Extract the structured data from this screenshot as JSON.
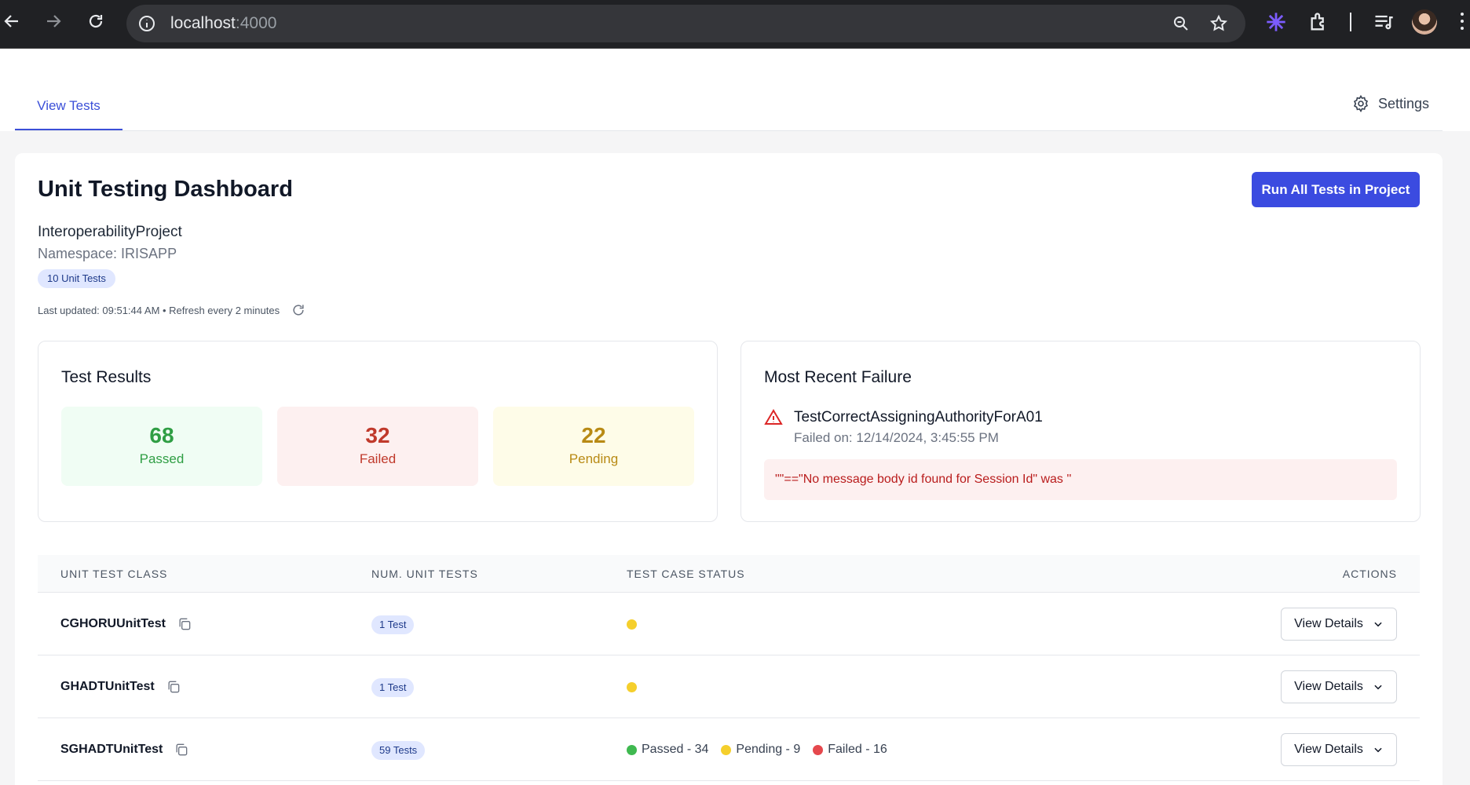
{
  "browser": {
    "url_host": "localhost",
    "url_port": ":4000"
  },
  "nav": {
    "active_tab": "View Tests",
    "settings_label": "Settings"
  },
  "dashboard": {
    "title": "Unit Testing Dashboard",
    "run_button": "Run All Tests in Project",
    "project": "InteroperabilityProject",
    "namespace": "Namespace: IRISAPP",
    "unit_test_count": "10 Unit Tests",
    "last_updated": "Last updated: 09:51:44 AM • Refresh every 2 minutes"
  },
  "results": {
    "heading": "Test Results",
    "passed": {
      "value": "68",
      "label": "Passed"
    },
    "failed": {
      "value": "32",
      "label": "Failed"
    },
    "pending": {
      "value": "22",
      "label": "Pending"
    }
  },
  "recent_failure": {
    "heading": "Most Recent Failure",
    "test_name": "TestCorrectAssigningAuthorityForA01",
    "failed_on": "Failed on: 12/14/2024, 3:45:55 PM",
    "message": "\"\"==\"No message body id found for Session Id\" was ''"
  },
  "table": {
    "headers": {
      "class": "UNIT TEST CLASS",
      "num": "NUM. UNIT TESTS",
      "status": "TEST CASE STATUS",
      "actions": "ACTIONS"
    },
    "view_label": "View Details",
    "rows": [
      {
        "name": "CGHORUUnitTest",
        "num": "1 Test"
      },
      {
        "name": "GHADTUnitTest",
        "num": "1 Test"
      },
      {
        "name": "SGHADTUnitTest",
        "num": "59 Tests",
        "passed": "Passed - 34",
        "pending": "Pending - 9",
        "failed": "Failed - 16"
      }
    ]
  },
  "colors": {
    "accent": "#3b4be0",
    "passed": "#2f9e44",
    "failed": "#c0392b",
    "pending": "#b88a14"
  }
}
